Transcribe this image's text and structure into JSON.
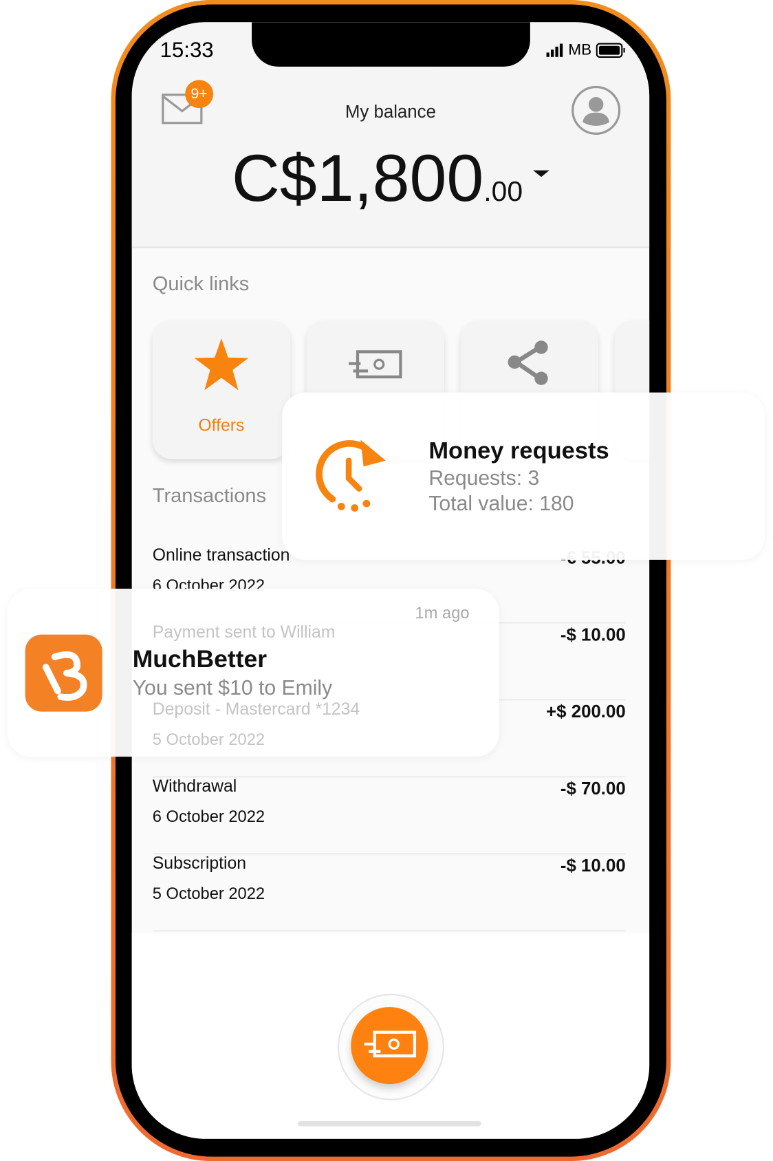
{
  "status_bar": {
    "time": "15:33",
    "carrier": "MB"
  },
  "header": {
    "title": "My balance",
    "balance_main": "C$1,800",
    "balance_cents": ".00",
    "inbox_badge": "9+"
  },
  "quick_links": {
    "title": "Quick links",
    "items": [
      {
        "label": "Offers",
        "icon": "star-icon"
      },
      {
        "label": "",
        "icon": "banknote-icon"
      },
      {
        "label": "",
        "icon": "share-icon"
      }
    ]
  },
  "transactions": {
    "title": "Transactions",
    "items": [
      {
        "name": "Online transaction",
        "date": "6 October 2022",
        "amount": "-€ 55.00"
      },
      {
        "name": "Payment sent to William",
        "date": "",
        "amount": "-$ 10.00"
      },
      {
        "name": "Deposit - Mastercard *1234",
        "date": "5 October 2022",
        "amount": "+$ 200.00"
      },
      {
        "name": "Withdrawal",
        "date": "6 October 2022",
        "amount": "-$ 70.00"
      },
      {
        "name": "Subscription",
        "date": "5 October 2022",
        "amount": "-$ 10.00"
      }
    ]
  },
  "money_requests": {
    "title": "Money requests",
    "requests": "Requests: 3",
    "total": "Total value: 180"
  },
  "notification": {
    "app": "MuchBetter",
    "message": "You sent $10 to Emily",
    "time": "1m ago"
  },
  "colors": {
    "accent": "#ff8210",
    "frame": "#f28c1c"
  }
}
